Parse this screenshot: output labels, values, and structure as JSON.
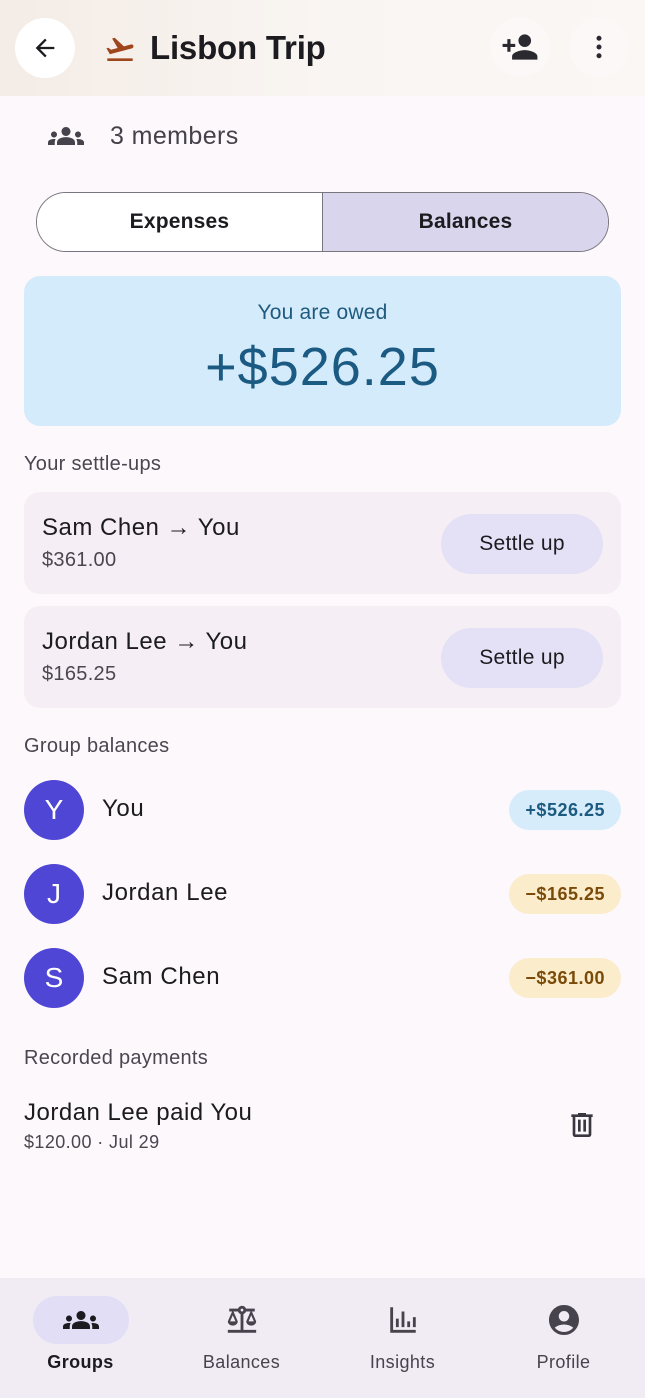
{
  "header": {
    "title": "Lisbon Trip",
    "back_icon": "arrow-back-icon",
    "title_icon": "flight-takeoff-icon",
    "add_member_icon": "person-add-icon",
    "more_icon": "more-vert-icon"
  },
  "members": {
    "icon": "group-icon",
    "text": "3 members"
  },
  "tabs": [
    {
      "label": "Expenses",
      "selected": false
    },
    {
      "label": "Balances",
      "selected": true
    }
  ],
  "summary": {
    "label": "You are owed",
    "amount": "+$526.25"
  },
  "settle_ups": {
    "heading": "Your settle-ups",
    "items": [
      {
        "name": "Sam Chen → You",
        "amount": "$361.00",
        "button": "Settle up"
      },
      {
        "name": "Jordan Lee → You",
        "amount": "$165.25",
        "button": "Settle up"
      }
    ]
  },
  "group_balances": {
    "heading": "Group balances",
    "items": [
      {
        "initial": "Y",
        "name": "You",
        "balance": "+$526.25",
        "status": "positive"
      },
      {
        "initial": "J",
        "name": "Jordan Lee",
        "balance": "−$165.25",
        "status": "negative"
      },
      {
        "initial": "S",
        "name": "Sam Chen",
        "balance": "−$361.00",
        "status": "negative"
      }
    ]
  },
  "payments": {
    "heading": "Recorded payments",
    "items": [
      {
        "title": "Jordan Lee paid You",
        "detail": "$120.00 · Jul 29",
        "delete_icon": "trash-icon"
      }
    ]
  },
  "nav": [
    {
      "label": "Groups",
      "icon": "group-icon",
      "active": true
    },
    {
      "label": "Balances",
      "icon": "scale-icon",
      "active": false
    },
    {
      "label": "Insights",
      "icon": "bar-chart-icon",
      "active": false
    },
    {
      "label": "Profile",
      "icon": "account-circle-icon",
      "active": false
    }
  ],
  "colors": {
    "accent": "#4f46d5",
    "brand_icon": "#a0461c",
    "positive_bg": "#d6ecfa",
    "negative_bg": "#fbeccc"
  }
}
